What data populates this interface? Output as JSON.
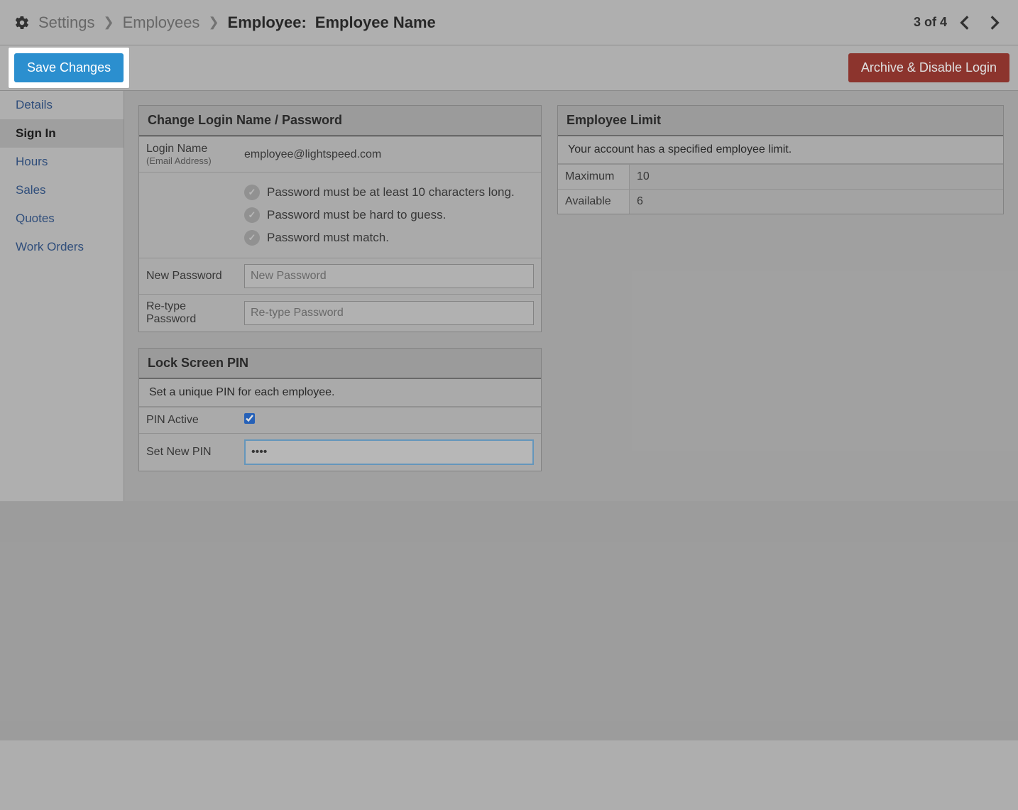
{
  "breadcrumb": {
    "settings": "Settings",
    "employees": "Employees",
    "current_prefix": "Employee:",
    "current_name": "Employee Name"
  },
  "pager": {
    "text": "3 of 4"
  },
  "actions": {
    "save": "Save Changes",
    "archive": "Archive & Disable Login"
  },
  "sidebar": {
    "items": [
      {
        "label": "Details",
        "active": false
      },
      {
        "label": "Sign In",
        "active": true
      },
      {
        "label": "Hours",
        "active": false
      },
      {
        "label": "Sales",
        "active": false
      },
      {
        "label": "Quotes",
        "active": false
      },
      {
        "label": "Work Orders",
        "active": false
      }
    ]
  },
  "login_panel": {
    "heading": "Change Login Name / Password",
    "login_label": "Login Name",
    "login_sublabel": "(Email Address)",
    "login_value": "employee@lightspeed.com",
    "rules": [
      "Password must be at least 10 characters long.",
      "Password must be hard to guess.",
      "Password must match."
    ],
    "new_pw_label": "New Password",
    "new_pw_placeholder": "New Password",
    "retype_pw_label": "Re-type Password",
    "retype_pw_placeholder": "Re-type Password"
  },
  "pin_panel": {
    "heading": "Lock Screen PIN",
    "note": "Set a unique PIN for each employee.",
    "active_label": "PIN Active",
    "active_checked": true,
    "new_pin_label": "Set New PIN",
    "new_pin_value": "••••"
  },
  "limit_panel": {
    "heading": "Employee Limit",
    "note": "Your account has a specified employee limit.",
    "max_label": "Maximum",
    "max_value": "10",
    "avail_label": "Available",
    "avail_value": "6"
  }
}
